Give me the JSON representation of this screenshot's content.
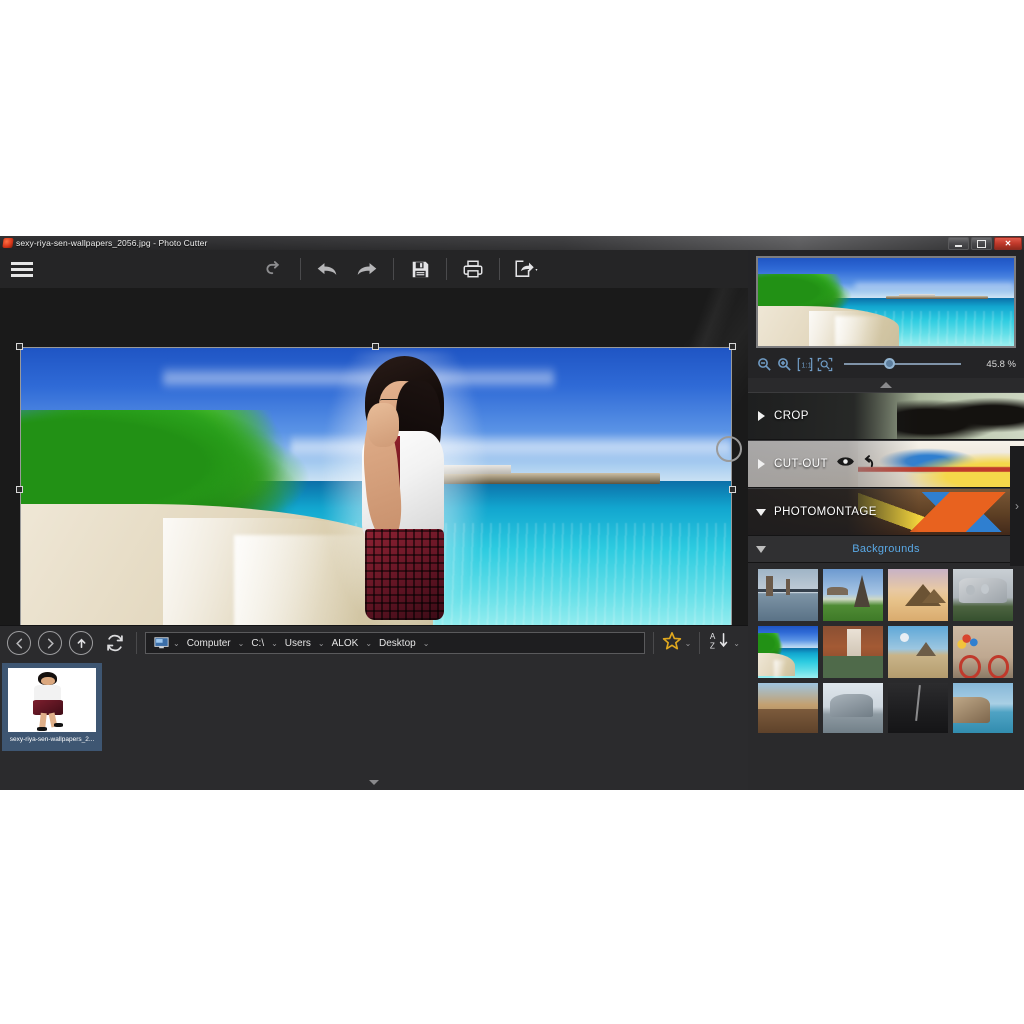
{
  "window": {
    "title": "sexy-riya-sen-wallpapers_2056.jpg - Photo Cutter",
    "app_icon": "flame-icon",
    "minimize_label": "–",
    "maximize_label": "❐",
    "close_label": "✕"
  },
  "toolbar": {
    "menu_label": "hamburger-menu",
    "items": [
      {
        "name": "reset-button",
        "icon": "reset-arrow-icon",
        "label": "Reset"
      },
      {
        "name": "undo-button",
        "icon": "undo-arrow-icon",
        "label": "Undo"
      },
      {
        "name": "redo-button",
        "icon": "redo-arrow-icon",
        "label": "Redo"
      },
      {
        "name": "save-button",
        "icon": "floppy-disk-icon",
        "label": "Save"
      },
      {
        "name": "print-button",
        "icon": "printer-icon",
        "label": "Print"
      },
      {
        "name": "export-button",
        "icon": "share-export-icon",
        "label": "Export"
      }
    ]
  },
  "canvas": {
    "image_alt": "tropical-beach-photomontage",
    "selection_handles": 8
  },
  "navigator": {
    "preview_alt": "tropical-beach-preview",
    "zoom_out_label": "zoom-out",
    "zoom_in_label": "zoom-in",
    "actual_size_label": "1:1",
    "fit_label": "fit-to-window",
    "zoom_value": "45.8 %",
    "zoom_percent": 45.8,
    "collapse_label": "collapse-navigator"
  },
  "panel": {
    "sections": [
      {
        "label": "CROP",
        "expanded": false,
        "arrow": "triangle-right",
        "icons": []
      },
      {
        "label": "CUT-OUT",
        "expanded": false,
        "arrow": "triangle-right",
        "icons": [
          "eye-icon",
          "undo-icon"
        ]
      },
      {
        "label": "PHOTOMONTAGE",
        "expanded": true,
        "arrow": "triangle-down",
        "icons": []
      }
    ],
    "backgrounds_tab": "Backgrounds",
    "expand_label": "›",
    "accent_color": "#5aa9e6"
  },
  "backgrounds": [
    {
      "name": "bridge",
      "selected": false
    },
    {
      "name": "eiffel-tower",
      "selected": false
    },
    {
      "name": "pyramids",
      "selected": false
    },
    {
      "name": "mount-rushmore",
      "selected": false
    },
    {
      "name": "tropical-beach",
      "selected": true
    },
    {
      "name": "waterfall",
      "selected": false
    },
    {
      "name": "desert-road",
      "selected": false
    },
    {
      "name": "bicycle-wall",
      "selected": false
    },
    {
      "name": "canyon",
      "selected": false
    },
    {
      "name": "rocky-mountain",
      "selected": false
    },
    {
      "name": "dark-scene",
      "selected": false
    },
    {
      "name": "coastal-cliffs",
      "selected": false
    }
  ],
  "browser": {
    "back_label": "←",
    "forward_label": "→",
    "up_label": "↑",
    "refresh_label": "refresh",
    "computer_icon": "computer-monitor-icon",
    "breadcrumb": [
      "Computer",
      "C:\\",
      "Users",
      "ALOK",
      "Desktop"
    ],
    "chevron": "⌄",
    "favorites_label": "favorites-star",
    "sort_label": "A↓"
  },
  "files": [
    {
      "label": "sexy-riya-sen-wallpapers_2...",
      "selected": true,
      "thumb": "girl-cutout"
    }
  ],
  "footer": {
    "collapse_label": "collapse-browser"
  }
}
